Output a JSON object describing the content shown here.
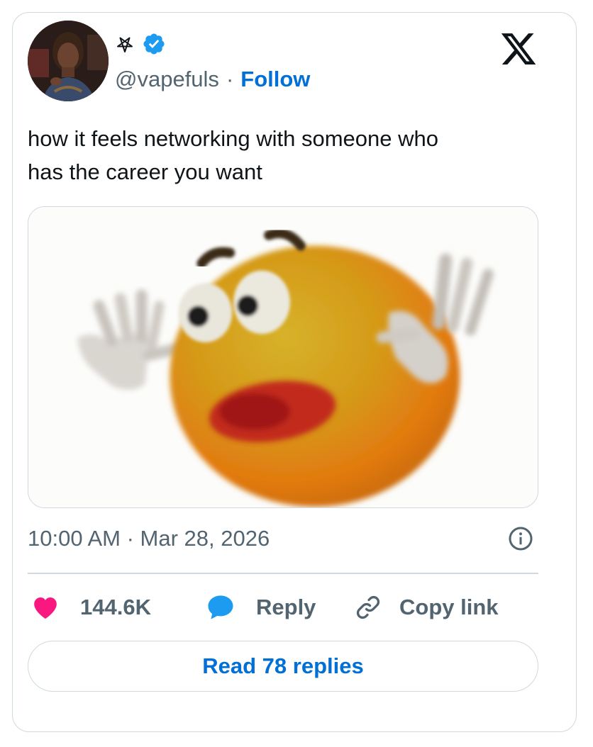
{
  "author": {
    "display_name_icon": "pentagram-icon",
    "verified_icon": "verified-badge-icon",
    "handle": "@vapefuls",
    "separator": "·",
    "follow_label": "Follow",
    "avatar": "avatar"
  },
  "platform_logo": "x-logo-icon",
  "tweet": {
    "line1": "how it feels networking with someone who",
    "line2": "has the career you want",
    "media": "meme-image-orange-emoji"
  },
  "meta": {
    "timestamp": "10:00 AM · Mar 28, 2026",
    "info_icon": "info-icon"
  },
  "actions": {
    "like_count": "144.6K",
    "reply_label": "Reply",
    "copy_label": "Copy link",
    "like_icon": "heart-icon",
    "reply_icon": "speech-bubble-icon",
    "copy_icon": "link-icon"
  },
  "read_replies_label": "Read 78 replies",
  "colors": {
    "accent": "#006fd6",
    "muted": "#536471",
    "border": "#cfd9de",
    "like": "#f91880",
    "reply": "#1d9bf0",
    "verified": "#1d9bf0"
  }
}
